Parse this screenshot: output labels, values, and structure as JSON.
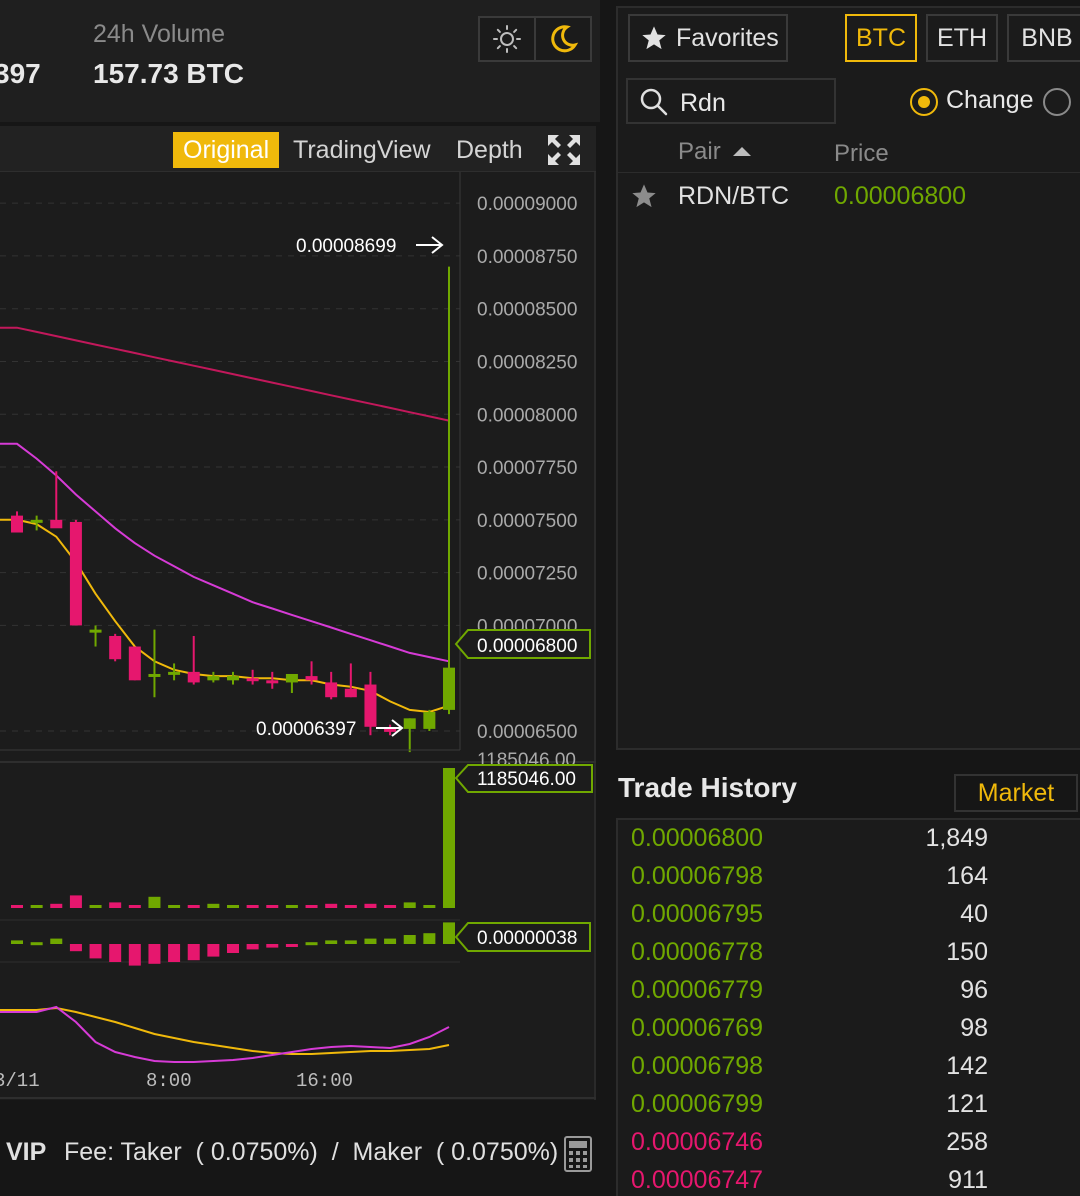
{
  "header": {
    "last_price_partial": "397",
    "volume_label": "24h Volume",
    "volume_value": "157.73 BTC"
  },
  "theme": {
    "light_icon": "sun-icon",
    "dark_icon": "moon-icon",
    "active": "dark"
  },
  "chart": {
    "tabs": [
      {
        "label": "Original",
        "active": true
      },
      {
        "label": "TradingView",
        "active": false
      },
      {
        "label": "Depth",
        "active": false
      }
    ],
    "fullscreen_icon": "expand-icon",
    "price_axis_labels": [
      "0.00009000",
      "0.00008750",
      "0.00008500",
      "0.00008250",
      "0.00008000",
      "0.00007750",
      "0.00007500",
      "0.00007250",
      "0.00007000",
      "0.00006500"
    ],
    "current_price_tag": "0.00006800",
    "high_marker": "0.00008699",
    "low_marker": "0.00006397",
    "volume_axis_top": "1185046.00",
    "volume_tag": "1185046.00",
    "macd_tag": "0.00000038",
    "time_labels": [
      "3/11",
      "8:00",
      "16:00"
    ]
  },
  "chart_data": {
    "type": "candlestick",
    "candles": [
      {
        "o": 7.52e-05,
        "h": 7.54e-05,
        "l": 7.44e-05,
        "c": 7.44e-05
      },
      {
        "o": 7.5e-05,
        "h": 7.52e-05,
        "l": 7.45e-05,
        "c": 7.5e-05
      },
      {
        "o": 7.5e-05,
        "h": 7.73e-05,
        "l": 7.47e-05,
        "c": 7.46e-05
      },
      {
        "o": 7.49e-05,
        "h": 7.5e-05,
        "l": 7e-05,
        "c": 7e-05
      },
      {
        "o": 6.98e-05,
        "h": 7e-05,
        "l": 6.9e-05,
        "c": 6.98e-05
      },
      {
        "o": 6.95e-05,
        "h": 6.96e-05,
        "l": 6.83e-05,
        "c": 6.84e-05
      },
      {
        "o": 6.9e-05,
        "h": 6.9e-05,
        "l": 6.74e-05,
        "c": 6.74e-05
      },
      {
        "o": 6.76e-05,
        "h": 6.98e-05,
        "l": 6.66e-05,
        "c": 6.77e-05
      },
      {
        "o": 6.77e-05,
        "h": 6.82e-05,
        "l": 6.74e-05,
        "c": 6.78e-05
      },
      {
        "o": 6.78e-05,
        "h": 6.95e-05,
        "l": 6.72e-05,
        "c": 6.73e-05
      },
      {
        "o": 6.74e-05,
        "h": 6.78e-05,
        "l": 6.73e-05,
        "c": 6.76e-05
      },
      {
        "o": 6.74e-05,
        "h": 6.78e-05,
        "l": 6.72e-05,
        "c": 6.76e-05
      },
      {
        "o": 6.75e-05,
        "h": 6.79e-05,
        "l": 6.72e-05,
        "c": 6.74e-05
      },
      {
        "o": 6.74e-05,
        "h": 6.78e-05,
        "l": 6.7e-05,
        "c": 6.73e-05
      },
      {
        "o": 6.73e-05,
        "h": 6.77e-05,
        "l": 6.68e-05,
        "c": 6.77e-05
      },
      {
        "o": 6.76e-05,
        "h": 6.83e-05,
        "l": 6.72e-05,
        "c": 6.74e-05
      },
      {
        "o": 6.73e-05,
        "h": 6.78e-05,
        "l": 6.65e-05,
        "c": 6.66e-05
      },
      {
        "o": 6.7e-05,
        "h": 6.82e-05,
        "l": 6.66e-05,
        "c": 6.66e-05
      },
      {
        "o": 6.72e-05,
        "h": 6.78e-05,
        "l": 6.48e-05,
        "c": 6.52e-05
      },
      {
        "o": 6.51e-05,
        "h": 6.53e-05,
        "l": 6.48e-05,
        "c": 6.5e-05
      },
      {
        "o": 6.51e-05,
        "h": 6.56e-05,
        "l": 6.4e-05,
        "c": 6.56e-05
      },
      {
        "o": 6.51e-05,
        "h": 6.6e-05,
        "l": 6.5e-05,
        "c": 6.59e-05
      },
      {
        "o": 6.6e-05,
        "h": 8.699e-05,
        "l": 6.58e-05,
        "c": 6.8e-05
      }
    ],
    "ylim": [
      6.41e-05,
      9.1e-05
    ],
    "ma_short": [
      7.5e-05,
      7.48e-05,
      7.42e-05,
      7.3e-05,
      7.15e-05,
      7.02e-05,
      6.9e-05,
      6.83e-05,
      6.79e-05,
      6.77e-05,
      6.76e-05,
      6.76e-05,
      6.75e-05,
      6.75e-05,
      6.74e-05,
      6.74e-05,
      6.72e-05,
      6.71e-05,
      6.69e-05,
      6.64e-05,
      6.6e-05,
      6.59e-05,
      6.62e-05
    ],
    "ma_mid": [
      7.86e-05,
      7.79e-05,
      7.71e-05,
      7.62e-05,
      7.54e-05,
      7.46e-05,
      7.39e-05,
      7.33e-05,
      7.28e-05,
      7.23e-05,
      7.19e-05,
      7.15e-05,
      7.11e-05,
      7.08e-05,
      7.05e-05,
      7.02e-05,
      6.99e-05,
      6.96e-05,
      6.93e-05,
      6.9e-05,
      6.87e-05,
      6.85e-05,
      6.83e-05
    ],
    "ma_long": [
      8.41e-05,
      8.39e-05,
      8.37e-05,
      8.35e-05,
      8.33e-05,
      8.31e-05,
      8.29e-05,
      8.27e-05,
      8.25e-05,
      8.23e-05,
      8.21e-05,
      8.19e-05,
      8.17e-05,
      8.15e-05,
      8.13e-05,
      8.11e-05,
      8.09e-05,
      8.07e-05,
      8.05e-05,
      8.03e-05,
      8.01e-05,
      7.99e-05,
      7.97e-05
    ]
  },
  "market": {
    "favorites_label": "Favorites",
    "star_icon": "star-icon",
    "quote_tabs": [
      {
        "label": "BTC",
        "active": true
      },
      {
        "label": "ETH",
        "active": false
      },
      {
        "label": "BNB",
        "active": false
      }
    ],
    "search_value": "Rdn",
    "search_icon": "search-icon",
    "radio_change_label": "Change",
    "col_pair": "Pair",
    "col_price": "Price",
    "rows": [
      {
        "pair": "RDN/BTC",
        "price": "0.00006800"
      }
    ]
  },
  "history": {
    "title": "Trade History",
    "tab_market": "Market",
    "trades": [
      {
        "price": "0.00006800",
        "amount": "1,849",
        "side": "up"
      },
      {
        "price": "0.00006798",
        "amount": "164",
        "side": "up"
      },
      {
        "price": "0.00006795",
        "amount": "40",
        "side": "up"
      },
      {
        "price": "0.00006778",
        "amount": "150",
        "side": "up"
      },
      {
        "price": "0.00006779",
        "amount": "96",
        "side": "up"
      },
      {
        "price": "0.00006769",
        "amount": "98",
        "side": "up"
      },
      {
        "price": "0.00006798",
        "amount": "142",
        "side": "up"
      },
      {
        "price": "0.00006799",
        "amount": "121",
        "side": "up"
      },
      {
        "price": "0.00006746",
        "amount": "258",
        "side": "down"
      },
      {
        "price": "0.00006747",
        "amount": "911",
        "side": "down"
      }
    ]
  },
  "footer": {
    "vip": "VIP",
    "fee_text": "Fee: Taker  ( 0.0750%)  /  Maker  ( 0.0750%)",
    "calc_icon": "calculator-icon"
  },
  "colors": {
    "accent": "#f0b90b",
    "up": "#70a800",
    "down": "#e6176e",
    "ma_short": "#f0b90b",
    "ma_mid": "#d63bd6",
    "ma_long": "#c2185b"
  }
}
